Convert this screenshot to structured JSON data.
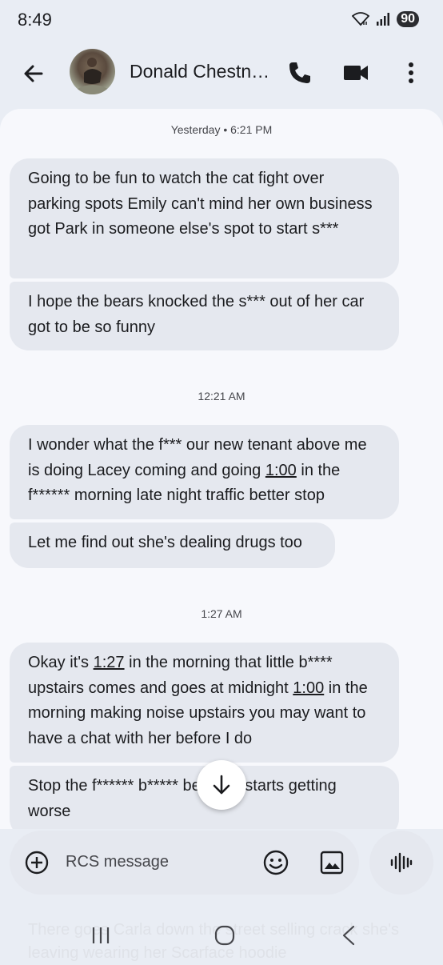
{
  "status": {
    "time": "8:49",
    "battery": "90"
  },
  "header": {
    "contact_name": "Donald Chestn…"
  },
  "timestamps": [
    "Yesterday • 6:21 PM",
    "12:21 AM",
    "1:27 AM"
  ],
  "messages": {
    "group1": {
      "m1": "Going to be fun to watch the cat fight over parking spots Emily can't mind her own business got Park in someone else's spot to start s***",
      "m2": "I hope the bears knocked the s*** out of her car got to be so funny"
    },
    "group2": {
      "m1_a": "I wonder what the f*** our new tenant above me is doing Lacey coming and going ",
      "m1_link": "1:00",
      "m1_b": " in the f****** morning late night traffic better stop",
      "m2": "Let me find out she's dealing drugs too"
    },
    "group3": {
      "m1_a": "Okay it's ",
      "m1_link1": "1:27",
      "m1_b": " in the morning that little b**** upstairs comes and goes at midnight ",
      "m1_link2": "1:00",
      "m1_c": " in the morning making noise upstairs you may want to have a chat with her before I do",
      "m2": "Stop the f****** b***** before it starts getting worse"
    }
  },
  "compose": {
    "placeholder": "RCS message"
  },
  "ghost_text": "There goes Carla down the street selling crack she's leaving wearing her Scarface hoodie",
  "colors": {
    "panel": "#f7f8fc",
    "bubble": "#e5e8ef",
    "background": "#e9edf4"
  },
  "icons": [
    "back-arrow-icon",
    "phone-icon",
    "video-icon",
    "more-vert-icon",
    "arrow-down-icon",
    "add-icon",
    "emoji-icon",
    "gallery-icon",
    "voice-icon",
    "recents-icon",
    "home-icon",
    "back-nav-icon"
  ]
}
